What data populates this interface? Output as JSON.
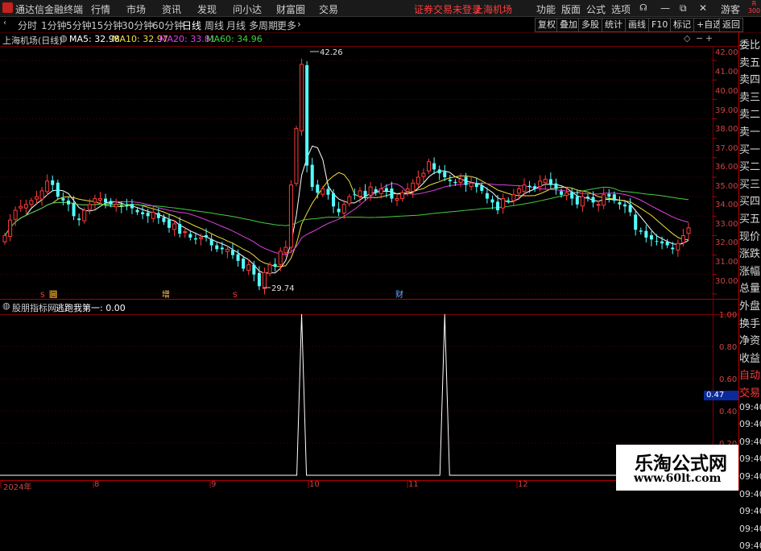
{
  "titlebar": {
    "app_name": "通达信金融终端",
    "menus": [
      "行情",
      "市场",
      "资讯",
      "发现",
      "问小达",
      "财富圈",
      "交易"
    ],
    "status": "证券交易未登录",
    "stock": "上海机场",
    "right_menus": [
      "功能",
      "版面",
      "公式",
      "选项"
    ],
    "user": "游客"
  },
  "toolbar": {
    "periods": [
      "分时",
      "1分钟",
      "5分钟",
      "15分钟",
      "30分钟",
      "60分钟",
      "日线",
      "周线",
      "月线",
      "多周期",
      "更多"
    ],
    "selected": "日线",
    "buttons": [
      "复权",
      "叠加",
      "多股",
      "统计",
      "画线",
      "F10",
      "标记",
      "+自选",
      "返回"
    ]
  },
  "main_chart": {
    "title": "上海机场(日线)",
    "ma_labels": [
      {
        "text": "MA5: 32.98",
        "color": "#ffffff"
      },
      {
        "text": "MA10: 32.97",
        "color": "#f0e040"
      },
      {
        "text": "MA20: 33.81",
        "color": "#e040e0"
      },
      {
        "text": "MA60: 34.96",
        "color": "#40d040"
      }
    ],
    "high_label": "42.26",
    "low_label": "29.74",
    "yticks": [
      "42.00",
      "41.00",
      "40.00",
      "39.00",
      "38.00",
      "37.00",
      "36.00",
      "35.00",
      "34.00",
      "33.00",
      "32.00",
      "31.00",
      "30.00"
    ],
    "markers": [
      "S",
      "回",
      "增",
      "S",
      "财"
    ]
  },
  "indicator": {
    "title": "股朋指标网",
    "label": "逃跑我第一: 0.00",
    "yticks": [
      "1.00",
      "0.80",
      "0.60",
      "0.40",
      "0.20"
    ],
    "current_value": "0.47"
  },
  "x_axis": {
    "labels": [
      "2024年",
      "8",
      "9",
      "10",
      "11",
      "12"
    ]
  },
  "sidebar": {
    "items": [
      "委比",
      "卖五",
      "卖四",
      "卖三",
      "卖二",
      "卖一",
      "买一",
      "买二",
      "买三",
      "买四",
      "买五",
      "现价",
      "涨跌",
      "涨幅",
      "总量",
      "外盘",
      "换手",
      "净资",
      "收益",
      "自动",
      "交易",
      "09:40",
      "09:40",
      "09:40",
      "09:40",
      "09:40",
      "09:40",
      "09:40",
      "09:40",
      "09:40"
    ],
    "top_badge": "R",
    "top_badge_sub": "300"
  },
  "watermark": {
    "title": "乐淘公式网",
    "url": "www.60lt.com"
  },
  "colors": {
    "up": "#ff3b3b",
    "down": "#54ffff",
    "grid": "#7a0000",
    "ma5": "#ffffff",
    "ma10": "#f0e040",
    "ma20": "#e040e0",
    "ma60": "#40d040"
  },
  "chart_data": {
    "type": "candlestick",
    "ylim": [
      29.5,
      42.5
    ],
    "closes": [
      33.0,
      33.8,
      34.3,
      34.5,
      34.6,
      34.8,
      35.0,
      35.3,
      35.8,
      35.6,
      35.0,
      34.8,
      34.6,
      34.0,
      33.8,
      34.3,
      34.6,
      34.9,
      34.9,
      34.7,
      34.6,
      34.6,
      34.5,
      34.5,
      34.4,
      34.2,
      34.1,
      34.0,
      34.2,
      33.9,
      33.7,
      33.4,
      33.6,
      33.1,
      33.2,
      32.9,
      32.8,
      32.9,
      32.9,
      32.5,
      32.3,
      32.3,
      32.3,
      32.0,
      31.7,
      31.3,
      31.5,
      31.0,
      30.4,
      31.1,
      31.5,
      31.4,
      32.2,
      32.4,
      35.6,
      38.5,
      41.8,
      36.6,
      35.5,
      35.2,
      35.4,
      35.1,
      34.5,
      34.2,
      34.6,
      35.0,
      35.1,
      35.3,
      35.0,
      35.5,
      35.2,
      35.4,
      35.3,
      34.9,
      34.9,
      35.2,
      35.4,
      35.7,
      36.0,
      36.2,
      36.8,
      36.4,
      36.2,
      36.0,
      35.8,
      35.7,
      35.9,
      35.6,
      35.7,
      35.5,
      35.3,
      34.9,
      34.7,
      34.3,
      34.9,
      34.8,
      35.1,
      35.4,
      35.6,
      35.5,
      35.4,
      35.8,
      35.9,
      35.6,
      35.4,
      35.1,
      35.2,
      34.9,
      34.6,
      35.0,
      34.9,
      34.7,
      34.6,
      35.1,
      35.0,
      34.8,
      34.6,
      34.5,
      34.2,
      33.3,
      33.2,
      32.9,
      32.8,
      32.7,
      32.6,
      32.5,
      32.3,
      32.6,
      33.0,
      33.4
    ],
    "signal_positions": [
      56,
      83
    ],
    "signal_value": 1.0
  }
}
